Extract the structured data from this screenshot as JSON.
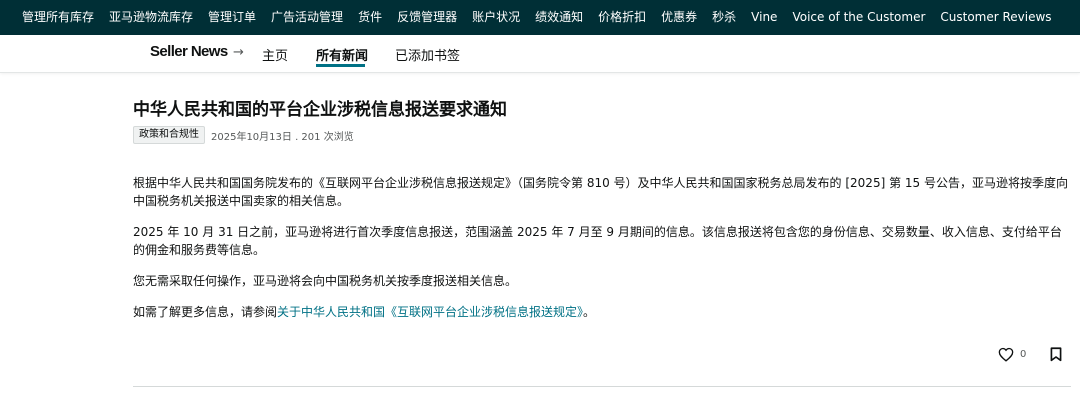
{
  "topnav": {
    "items": [
      "管理所有库存",
      "亚马逊物流库存",
      "管理订单",
      "广告活动管理",
      "货件",
      "反馈管理器",
      "账户状况",
      "绩效通知",
      "价格折扣",
      "优惠券",
      "秒杀",
      "Vine",
      "Voice of the Customer",
      "Customer Reviews"
    ]
  },
  "subnav": {
    "logo": "Seller News",
    "arrow": "→",
    "home": "主页",
    "all_news": "所有新闻",
    "bookmarks": "已添加书签"
  },
  "article": {
    "title": "中华人民共和国的平台企业涉税信息报送要求通知",
    "tag": "政策和合规性",
    "meta": "2025年10月13日 . 201 次浏览",
    "paragraphs": [
      "根据中华人民共和国国务院发布的《互联网平台企业涉税信息报送规定》（国务院令第 810 号）及中华人民共和国国家税务总局发布的 [2025] 第 15 号公告，亚马逊将按季度向中国税务机关报送中国卖家的相关信息。",
      "2025 年 10 月 31 日之前，亚马逊将进行首次季度信息报送，范围涵盖 2025 年 7 月至 9 月期间的信息。该信息报送将包含您的身份信息、交易数量、收入信息、支付给平台的佣金和服务费等信息。",
      "您无需采取任何操作，亚马逊将会向中国税务机关按季度报送相关信息。"
    ],
    "last_prefix": "如需了解更多信息，请参阅",
    "link_text": "关于中华人民共和国《互联网平台企业涉税信息报送规定》",
    "last_suffix": "。",
    "like_count": "0"
  },
  "colors": {
    "nav_bg": "#002f36",
    "accent": "#007185"
  }
}
